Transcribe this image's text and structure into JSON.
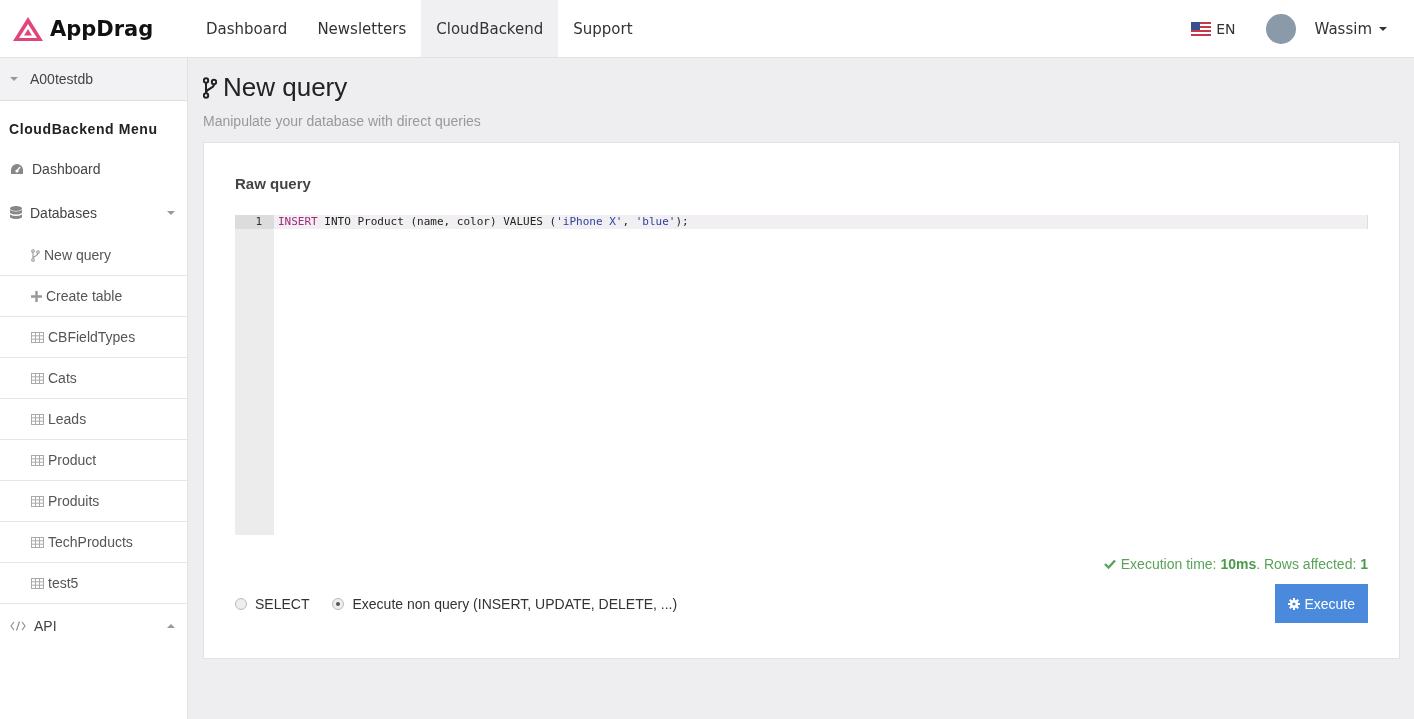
{
  "header": {
    "logo": "AppDrag",
    "nav": [
      {
        "label": "Dashboard",
        "selected": false
      },
      {
        "label": "Newsletters",
        "selected": false
      },
      {
        "label": "CloudBackend",
        "selected": true
      },
      {
        "label": "Support",
        "selected": false
      }
    ],
    "language": "EN",
    "user": "Wassim"
  },
  "sidebar": {
    "database": "A00testdb",
    "menu_title": "CloudBackend Menu",
    "items": [
      {
        "label": "Dashboard",
        "kind": "dashboard"
      },
      {
        "label": "Databases",
        "kind": "database",
        "expanded": true,
        "children": [
          {
            "label": "New query",
            "kind": "query"
          },
          {
            "label": "Create table",
            "kind": "create"
          },
          {
            "label": "CBFieldTypes",
            "kind": "table"
          },
          {
            "label": "Cats",
            "kind": "table"
          },
          {
            "label": "Leads",
            "kind": "table"
          },
          {
            "label": "Product",
            "kind": "table"
          },
          {
            "label": "Produits",
            "kind": "table"
          },
          {
            "label": "TechProducts",
            "kind": "table"
          },
          {
            "label": "test5",
            "kind": "table"
          }
        ]
      },
      {
        "label": "API",
        "kind": "api",
        "expanded": false
      }
    ]
  },
  "page": {
    "title": "New query",
    "subtitle": "Manipulate your database with direct queries"
  },
  "query_panel": {
    "heading": "Raw query",
    "editor": {
      "lines": [
        {
          "number": "1",
          "tokens": [
            {
              "text": "INSERT",
              "kind": "keyword"
            },
            {
              "text": " INTO Product (name, color) VALUES (",
              "kind": "plain"
            },
            {
              "text": "'iPhone X'",
              "kind": "string"
            },
            {
              "text": ", ",
              "kind": "plain"
            },
            {
              "text": "'blue'",
              "kind": "string"
            },
            {
              "text": ");",
              "kind": "plain"
            }
          ]
        }
      ]
    },
    "status": "Execution time: **10ms**. Rows affected: **1**",
    "modes": [
      {
        "label": "SELECT",
        "selected": false
      },
      {
        "label": "Execute non query (INSERT, UPDATE, DELETE, ...)",
        "selected": true
      }
    ],
    "execute_button": "Execute"
  }
}
